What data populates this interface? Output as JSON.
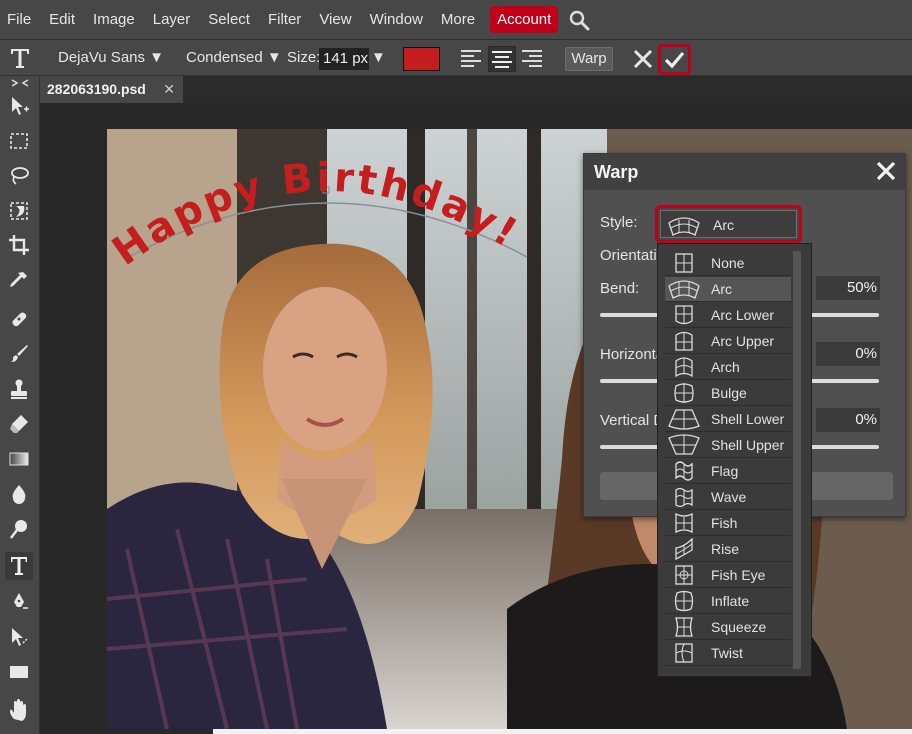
{
  "menubar": {
    "items": [
      "File",
      "Edit",
      "Image",
      "Layer",
      "Select",
      "Filter",
      "View",
      "Window",
      "More"
    ],
    "account": "Account",
    "accent": "#c0001a"
  },
  "options": {
    "tool_icon": "type-tool-icon",
    "font_family": "DejaVu Sans ▼",
    "font_style": "Condensed ▼",
    "size_label": "Size:",
    "size_value": "141 px",
    "size_arrow": "▼",
    "text_color": "#c41e1e",
    "warp_label": "Warp"
  },
  "tab": {
    "name": "282063190.psd",
    "close": "✕"
  },
  "canvas": {
    "text": "Happy Birthday!",
    "text_color": "#c41e1e"
  },
  "warp": {
    "title": "Warp",
    "style_label": "Style:",
    "style_value": "Arc",
    "orientation_label": "Orientation:",
    "bend_label": "Bend:",
    "bend_value": "50%",
    "horizontal_label": "Horizontal Distortion:",
    "horizontal_value": "0%",
    "vertical_label": "Vertical Distortion:",
    "vertical_value": "0%",
    "styles": [
      "None",
      "Arc",
      "Arc Lower",
      "Arc Upper",
      "Arch",
      "Bulge",
      "Shell Lower",
      "Shell Upper",
      "Flag",
      "Wave",
      "Fish",
      "Rise",
      "Fish Eye",
      "Inflate",
      "Squeeze",
      "Twist"
    ],
    "selected_style": "Arc"
  }
}
